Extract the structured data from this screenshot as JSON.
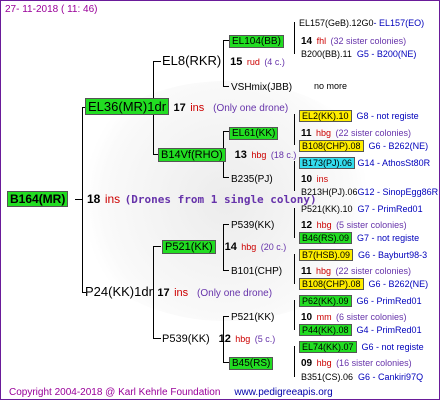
{
  "header": {
    "date": "27- 11-2018 ( 11: 46)"
  },
  "footer": {
    "copyright": "Copyright 2004-2018 @ Karl Kehrle Foundation",
    "url": "www.pedigreeapis.org"
  },
  "root": {
    "name": "B164(MR)",
    "count": "18",
    "ins": "ins",
    "note": "(Drones from 1 single colony)"
  },
  "gen1": {
    "top": {
      "name": "EL36(MR)1dr",
      "count": "17",
      "ins": "ins",
      "note": "(Only one drone)"
    },
    "bottom": {
      "name": "P24(KK)1dr",
      "count": "17",
      "ins": "ins",
      "note": "(Only one drone)"
    }
  },
  "gen2": {
    "el8": {
      "name": "EL8(RKR)",
      "count": "15",
      "ins": "rud",
      "note": "(4 c.)"
    },
    "b14": {
      "name": "B14Vf(RHO)",
      "count": "13",
      "ins": "hbg",
      "note": "(18 c.)"
    },
    "p521": {
      "name": "P521(KK)",
      "count": "14",
      "ins": "hbg",
      "note": "(20 c.)"
    },
    "p539": {
      "name": "P539(KK)",
      "count": "12",
      "ins": "hbg",
      "note": "(5 c.)"
    }
  },
  "gen3": {
    "el104": {
      "name": "EL104(BB)",
      "count": "14",
      "ins": "fhl",
      "note": "(32 sister colonies)"
    },
    "vsh": {
      "name": "VSHmix(JBB)",
      "note": "no more"
    },
    "el61": {
      "name": "EL61(KK)",
      "count": "11",
      "ins": "hbg",
      "note": "(22 sister colonies)"
    },
    "b235": {
      "name": "B235(PJ)",
      "count": "10",
      "ins": "ins"
    },
    "p539a": {
      "name": "P539(KK)",
      "count": "12",
      "ins": "hbg",
      "note": "(5 sister colonies)"
    },
    "b101": {
      "name": "B101(CHP)",
      "count": "11",
      "ins": "hbg",
      "note": "(22 sister colonies)"
    },
    "p521a": {
      "name": "P521(KK)",
      "count": "10",
      "ins": "mm",
      "note": "(6 sister colonies)"
    },
    "b45": {
      "name": "B45(RS)",
      "count": "09",
      "ins": "hbg",
      "note": "(16 sister colonies)"
    }
  },
  "gen4": [
    {
      "name": "EL157(GeB).12G0",
      "info": "- EL157(EO)"
    },
    {
      "name": "B200(BB).11",
      "info": "G5 - B200(NE)"
    },
    {
      "name": "EL2(KK).10",
      "info": "G8 - not registe"
    },
    {
      "name": "B108(CHP).08",
      "info": "G6 - B262(NE)"
    },
    {
      "name": "B173(PJ).06",
      "info": "G14 - AthosSt80R"
    },
    {
      "name": "B213H(PJ).06",
      "info": "G12 - SinopEgg86R"
    },
    {
      "name": "P521(KK).10",
      "info": "G7 - PrimRed01"
    },
    {
      "name": "B46(RS).09",
      "info": "G7 - not registe"
    },
    {
      "name": "B7(HSB).09",
      "info": "G6 - Bayburt98-3"
    },
    {
      "name": "B108(CHP).08",
      "info": "G6 - B262(NE)"
    },
    {
      "name": "P62(KK).09",
      "info": "G6 - PrimRed01"
    },
    {
      "name": "P44(KK).08",
      "info": "G4 - PrimRed01"
    },
    {
      "name": "EL74(KK).07",
      "info": "G6 - not registe"
    },
    {
      "name": "B351(CS).06",
      "info": "G6 - Cankiri97Q"
    }
  ]
}
